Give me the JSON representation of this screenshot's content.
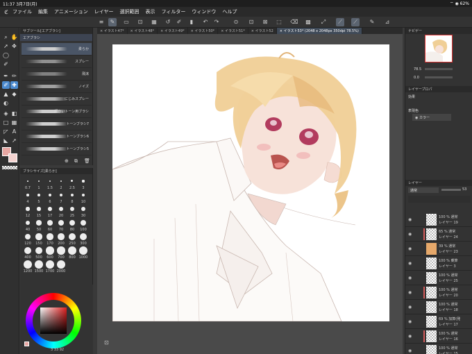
{
  "status": {
    "time": "11:37",
    "date": "3月7日(月)",
    "battery": "62%"
  },
  "menu": [
    "ファイル",
    "編集",
    "アニメーション",
    "レイヤー",
    "選択範囲",
    "表示",
    "フィルター",
    "ウィンドウ",
    "ヘルプ"
  ],
  "tabs": [
    {
      "label": "× イラスト47*"
    },
    {
      "label": "× イラスト48*"
    },
    {
      "label": "× イラスト49*"
    },
    {
      "label": "× イラスト50*"
    },
    {
      "label": "× イラスト51*"
    },
    {
      "label": "× イラスト52"
    },
    {
      "label": "× イラスト53* (2048 x 2048px 350dpi 78.5%)"
    }
  ],
  "subtool": {
    "header": "サブツール[エアブラシ]",
    "group": "エアブラシ",
    "brushes": [
      {
        "name": "柔らか"
      },
      {
        "name": "スプレー"
      },
      {
        "name": "飛沫"
      },
      {
        "name": "ノイズ"
      },
      {
        "name": "にじみスプレー"
      },
      {
        "name": "細かいトーン用ブラシ"
      },
      {
        "name": "トーンブラシ7"
      },
      {
        "name": "トーンブラシ6"
      },
      {
        "name": "トーンブラシ5"
      }
    ]
  },
  "brushsize": {
    "header": "ブラシサイズ[柔らか]",
    "sizes": [
      "0.7",
      "1",
      "1.5",
      "2",
      "2.5",
      "3",
      "4",
      "5",
      "6",
      "7",
      "8",
      "10",
      "12",
      "15",
      "17",
      "20",
      "25",
      "30",
      "40",
      "50",
      "60",
      "70",
      "80",
      "100",
      "120",
      "150",
      "170",
      "200",
      "250",
      "300",
      "400",
      "500",
      "600",
      "700",
      "800",
      "1000",
      "1200",
      "1500",
      "1700",
      "2000"
    ]
  },
  "color": {
    "main": "#e8a7a3",
    "sub": "#f3d2cf",
    "values": [
      "3",
      "33",
      "92"
    ]
  },
  "navigator": {
    "header": "ナビゲー",
    "zoom": "78.5",
    "rotation": "0.0"
  },
  "layer_property": {
    "header": "レイヤープロパ",
    "effect": "効果",
    "expression": "表現色",
    "expression_value": "カラー"
  },
  "layer_panel": {
    "header": "レイヤー",
    "blend": "通常",
    "opacity": "53",
    "layers": [
      {
        "opacity": "100 %",
        "mode": "通常",
        "name": "レイヤー 19",
        "orange": false,
        "clip": false
      },
      {
        "opacity": "65 %",
        "mode": "通常",
        "name": "レイヤー 24",
        "orange": false,
        "clip": true
      },
      {
        "opacity": "39 %",
        "mode": "通常",
        "name": "レイヤー 23",
        "orange": true,
        "clip": false
      },
      {
        "opacity": "100 %",
        "mode": "乗算",
        "name": "レイヤー 3",
        "orange": false,
        "clip": false
      },
      {
        "opacity": "100 %",
        "mode": "通常",
        "name": "レイヤー 25",
        "orange": false,
        "clip": false
      },
      {
        "opacity": "100 %",
        "mode": "通常",
        "name": "レイヤー 20",
        "orange": false,
        "clip": true
      },
      {
        "opacity": "100 %",
        "mode": "通常",
        "name": "レイヤー 18",
        "orange": false,
        "clip": false
      },
      {
        "opacity": "69 %",
        "mode": "加算(発",
        "name": "レイヤー 17",
        "orange": false,
        "clip": false
      },
      {
        "opacity": "100 %",
        "mode": "通常",
        "name": "レイヤー 16",
        "orange": false,
        "clip": true
      },
      {
        "opacity": "100 %",
        "mode": "通常",
        "name": "レイヤー 15",
        "orange": false,
        "clip": false
      }
    ]
  }
}
